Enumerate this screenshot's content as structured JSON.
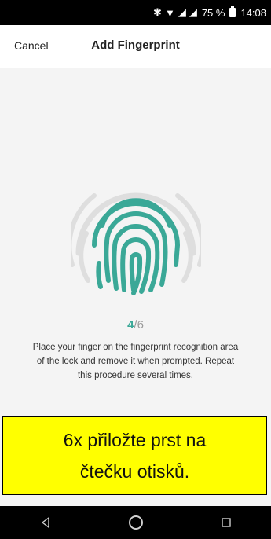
{
  "status_bar": {
    "battery": "75 %",
    "time": "14:08"
  },
  "header": {
    "cancel_label": "Cancel",
    "title": "Add Fingerprint"
  },
  "progress": {
    "current": "4",
    "separator": "/",
    "total": "6"
  },
  "instruction": "Place your finger on the fingerprint recognition area of the lock and remove it when prompted. Repeat this procedure several times.",
  "overlay": {
    "text": "6x přiložte prst na čtečku otisků."
  },
  "colors": {
    "accent": "#3aa897",
    "ghost": "#dedede",
    "overlay_bg": "#ffff00"
  }
}
